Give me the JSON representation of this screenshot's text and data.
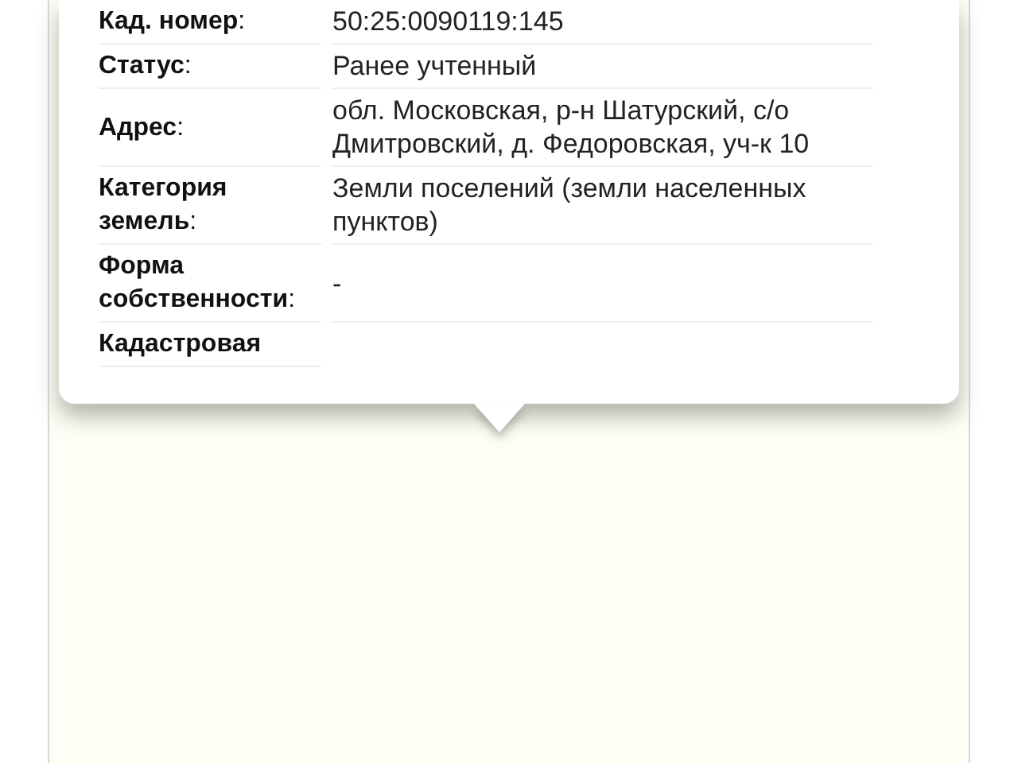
{
  "popup": {
    "rows": [
      {
        "label": "**Кад. номер**:",
        "value": "50:25:0090119:145"
      },
      {
        "label": "**Статус**:",
        "value": "Ранее учтенный"
      },
      {
        "label": "**Адрес**:",
        "value": "обл. Московская, р-н Шатурский, с/о Дмитровский, д. Федоровская, уч-к 10"
      },
      {
        "label": "**Категория земель**:",
        "value": "Земли поселений (земли населенных пунктов)"
      },
      {
        "label": "**Форма собственности**:",
        "value": "-"
      },
      {
        "label": "**Кадастровая**"
      }
    ]
  }
}
